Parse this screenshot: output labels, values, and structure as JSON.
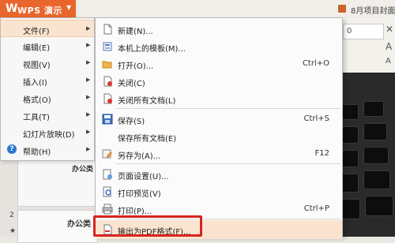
{
  "titlebar": {
    "app_logo": "W",
    "app_label": "WPS 演示",
    "app_arrow": "▼",
    "doc_title": "8月项目封面"
  },
  "ribbon": {
    "font_size": "0",
    "grow_symbol": "A",
    "shrink_symbol": "A",
    "clear_symbol": "✕"
  },
  "slides_panel": {
    "thumb1_text": "办公类",
    "slide2_number": "2",
    "slide2_star": "★",
    "thumb2_text": "办公类"
  },
  "left_menu": {
    "items": [
      {
        "label": "文件(F)",
        "arrow": "▶"
      },
      {
        "label": "编辑(E)",
        "arrow": "▶"
      },
      {
        "label": "视图(V)",
        "arrow": "▶"
      },
      {
        "label": "插入(I)",
        "arrow": "▶"
      },
      {
        "label": "格式(O)",
        "arrow": "▶"
      },
      {
        "label": "工具(T)",
        "arrow": "▶"
      },
      {
        "label": "幻灯片放映(D)",
        "arrow": "▶"
      },
      {
        "label": "帮助(H)",
        "arrow": "▶"
      }
    ],
    "help_icon": "?"
  },
  "file_menu": {
    "items": [
      {
        "label": "新建(N)...",
        "shortcut": "",
        "icon": "new-doc-icon"
      },
      {
        "label": "本机上的模板(M)...",
        "shortcut": "",
        "icon": "template-icon"
      },
      {
        "label": "打开(O)...",
        "shortcut": "Ctrl+O",
        "icon": "open-folder-icon"
      },
      {
        "label": "关闭(C)",
        "shortcut": "",
        "icon": "close-doc-icon"
      },
      {
        "label": "关闭所有文档(L)",
        "shortcut": "",
        "icon": "close-all-icon"
      },
      {
        "label": "保存(S)",
        "shortcut": "Ctrl+S",
        "icon": "save-icon"
      },
      {
        "label": "保存所有文档(E)",
        "shortcut": "",
        "icon": ""
      },
      {
        "label": "另存为(A)...",
        "shortcut": "F12",
        "icon": "save-as-icon"
      },
      {
        "label": "页面设置(U)...",
        "shortcut": "",
        "icon": "page-setup-icon"
      },
      {
        "label": "打印预览(V)",
        "shortcut": "",
        "icon": "print-preview-icon"
      },
      {
        "label": "打印(P)...",
        "shortcut": "Ctrl+P",
        "icon": "print-icon"
      },
      {
        "label": "输出为PDF格式(F)...",
        "shortcut": "",
        "icon": "export-pdf-icon"
      }
    ]
  },
  "colors": {
    "wps_orange": "#e8662b",
    "menu_highlight": "#fbe4cf",
    "callout_red": "#d9241e"
  }
}
